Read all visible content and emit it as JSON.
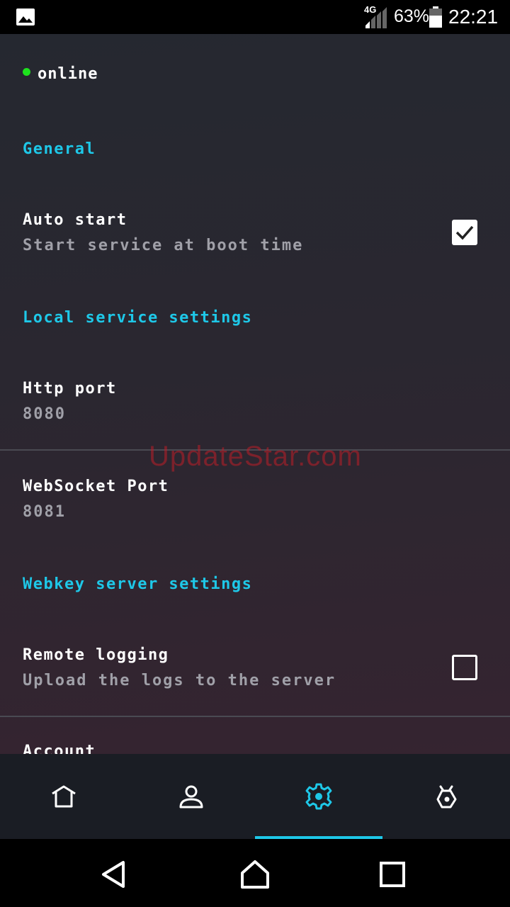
{
  "status_bar": {
    "network_type": "4G",
    "battery_percent": "63%",
    "time": "22:21",
    "icons": [
      "gallery-icon",
      "signal-icon",
      "battery-icon"
    ]
  },
  "connection": {
    "status": "online",
    "dot_color": "#1de21d"
  },
  "sections": {
    "general": {
      "header": "General",
      "auto_start": {
        "title": "Auto start",
        "summary": "Start service at boot time",
        "checked": true
      }
    },
    "local": {
      "header": "Local service settings",
      "http_port": {
        "title": "Http port",
        "value": "8080"
      },
      "websocket_port": {
        "title": "WebSocket Port",
        "value": "8081"
      }
    },
    "server": {
      "header": "Webkey server settings",
      "remote_logging": {
        "title": "Remote logging",
        "summary": "Upload the logs to the server",
        "checked": false
      },
      "account": {
        "title": "Account"
      }
    }
  },
  "watermark": "UpdateStar.com",
  "bottom_nav": {
    "tabs": [
      "home-icon",
      "person-icon",
      "settings-icon",
      "robot-icon"
    ],
    "active_tab": 2,
    "accent_color": "#1ec8e8"
  },
  "system_nav": [
    "back-icon",
    "home-icon",
    "recents-icon"
  ]
}
